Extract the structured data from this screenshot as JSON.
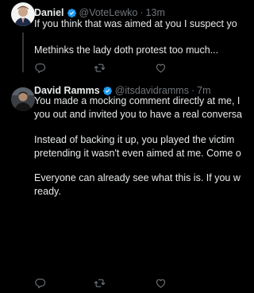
{
  "colors": {
    "background": "#000000",
    "text": "#e7e9ea",
    "muted": "#71767b",
    "verified": "#1d9bf0",
    "thread_line": "#333639"
  },
  "tweets": [
    {
      "display_name": "Daniel",
      "handle": "@VoteLewko",
      "separator": "·",
      "time": "13m",
      "verified_icon": "verified-badge-icon",
      "lines": [
        "If you think that was aimed at you I suspect yo",
        "Methinks the lady doth protest too much..."
      ]
    },
    {
      "display_name": "David Ramms",
      "handle": "@itsdavidramms",
      "separator": "·",
      "time": "7m",
      "verified_icon": "verified-badge-icon",
      "lines": [
        "You made a mocking comment directly at me, I",
        "you out and invited you to have a real conversa",
        "Instead of backing it up, you played the victim",
        "pretending it wasn't even aimed at me. Come o",
        "Everyone can already see what this is. If you w",
        "ready."
      ]
    }
  ],
  "action_icons": [
    "reply-icon",
    "retweet-icon",
    "like-icon"
  ]
}
